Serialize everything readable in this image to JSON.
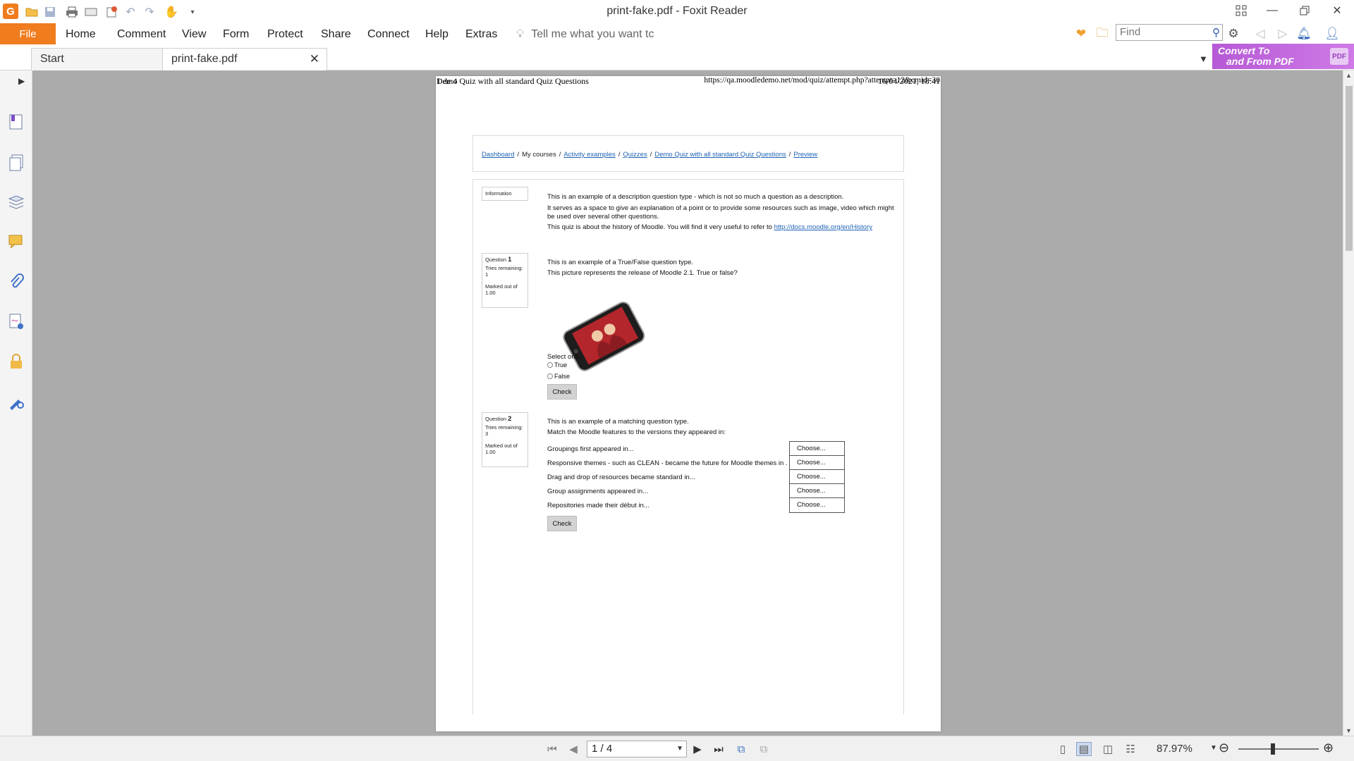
{
  "window": {
    "title": "print-fake.pdf - Foxit Reader",
    "logo": "G"
  },
  "quick_access": {
    "icons": [
      "open-folder-icon",
      "save-icon",
      "print-icon",
      "scan-icon",
      "new-icon",
      "undo-icon",
      "redo-icon",
      "hand-tool-icon",
      "customize-icon"
    ]
  },
  "menu": {
    "file": "File",
    "items": [
      "Home",
      "Comment",
      "View",
      "Form",
      "Protect",
      "Share",
      "Connect",
      "Help",
      "Extras"
    ],
    "tell_me": "Tell me what you want tc"
  },
  "search": {
    "placeholder": "Find"
  },
  "tabs": {
    "start": "Start",
    "document": "print-fake.pdf"
  },
  "convert_banner": {
    "line1": "Convert To",
    "line2": "and From PDF",
    "badge": "PDF"
  },
  "left_panel": {
    "icons": [
      "bookmark-icon",
      "pages-icon",
      "layers-icon",
      "comments-icon",
      "attachments-icon",
      "signature-icon",
      "security-icon",
      "sign-tool-icon"
    ]
  },
  "pdf": {
    "header_left": "Demo Quiz with all standard Quiz Questions",
    "header_right": "https://qa.moodledemo.net/mod/quiz/attempt.php?attempt=12&cmid=30",
    "footer_left": "1 de 4",
    "footer_right": "16/04/2021, 18:41",
    "breadcrumb": {
      "items": [
        "Dashboard",
        "My courses",
        "Activity examples",
        "Quizzes",
        "Demo Quiz with all standard Quiz Questions",
        "Preview"
      ],
      "separator": "/"
    },
    "information": {
      "label": "Information",
      "p1": "This is an example of a description question type - which is not so much a question as a description.",
      "p2": "It serves as a space to give an explanation of a point or to provide some resources such as image, video which might be used over several other questions.",
      "p3_text": "This quiz is about the history of Moodle. You will find it very useful to refer to",
      "p3_link": "http://docs.moodle.org/en/History"
    },
    "question1": {
      "label": "Question",
      "number": "1",
      "tries_label": "Tries remaining:",
      "tries": "1",
      "marked_label": "Marked out of",
      "marked": "1.00",
      "text1": "This is an example of a True/False question type.",
      "text2": "This picture represents the release of  Moodle 2.1. True or false?",
      "select_one": "Select one:",
      "option_true": "True",
      "option_false": "False",
      "check": "Check"
    },
    "question2": {
      "label": "Question",
      "number": "2",
      "tries_label": "Tries remaining:",
      "tries": "3",
      "marked_label": "Marked out of",
      "marked": "1.00",
      "text1": "This is an example of a matching question type.",
      "text2": "Match the Moodle features to the versions they appeared in:",
      "rows": [
        "Groupings first appeared in...",
        "Responsive themes - such as CLEAN - became the future for Moodle themes in ...",
        "Drag and drop of resources became standard in...",
        "Group assignments appeared in...",
        "Repositories made their début in..."
      ],
      "choose": "Choose...",
      "check": "Check"
    }
  },
  "status": {
    "page": "1 / 4",
    "zoom": "87.97%"
  }
}
